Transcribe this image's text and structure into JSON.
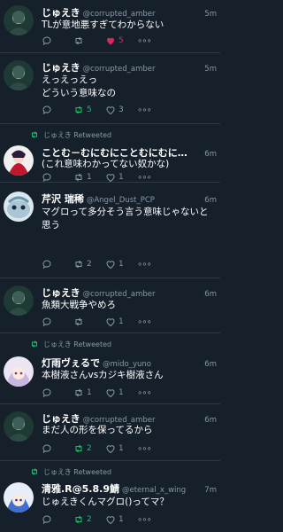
{
  "tweets": [
    {
      "retweeted_by": "",
      "name": "じゅえき",
      "handle": "@corrupted_amber",
      "time": "5m",
      "text": "TLが意地悪すぎてわからない",
      "reply": "",
      "retweet": "",
      "like": "5",
      "more": "∘∘∘"
    },
    {
      "retweeted_by": "",
      "name": "じゅえき",
      "handle": "@corrupted_amber",
      "time": "5m",
      "text": "えっえっえっ\nどういう意味なの",
      "reply": "",
      "retweet": "5",
      "like": "3",
      "more": "∘∘∘"
    },
    {
      "retweeted_by": "じゅえき Retweeted",
      "name": "ことむ－むにむにことむにむに…",
      "handle": "",
      "time": "6m",
      "text": "(これ意味わかってない奴かな)",
      "reply": "",
      "retweet": "1",
      "like": "1",
      "more": "∘∘∘"
    },
    {
      "retweeted_by": "",
      "name": "芹沢 瑞稀",
      "handle": "@Angel_Dust_PCP",
      "time": "6m",
      "text": "マグロって多分そう言う意味じゃないと思う",
      "reply": "",
      "retweet": "2",
      "like": "1",
      "more": "∘∘∘"
    },
    {
      "retweeted_by": "",
      "name": "じゅえき",
      "handle": "@corrupted_amber",
      "time": "6m",
      "text": "魚類大戦争やめろ",
      "reply": "",
      "retweet": "",
      "like": "1",
      "more": "∘∘∘"
    },
    {
      "retweeted_by": "じゅえき Retweeted",
      "name": "灯雨ヴぇるで",
      "handle": "@mido_yuno",
      "time": "6m",
      "text": "本樹液さんvsカジキ樹液さん",
      "reply": "",
      "retweet": "1",
      "like": "1",
      "more": "∘∘∘"
    },
    {
      "retweeted_by": "",
      "name": "じゅえき",
      "handle": "@corrupted_amber",
      "time": "6m",
      "text": "まだ人の形を保ってるから",
      "reply": "",
      "retweet": "2",
      "like": "1",
      "more": "∘∘∘"
    },
    {
      "retweeted_by": "じゅえき Retweeted",
      "name": "清雅.R@5.8.9鯖",
      "handle": "@eternal_x_wing",
      "time": "7m",
      "text": "じゅえきくんマグロ()ってマ？",
      "reply": "",
      "retweet": "2",
      "like": "1",
      "more": "∘∘∘"
    }
  ],
  "colors": {
    "background": "#15202b",
    "retweet": "#17bf63",
    "like": "#e0245e",
    "muted": "#8899a6"
  }
}
